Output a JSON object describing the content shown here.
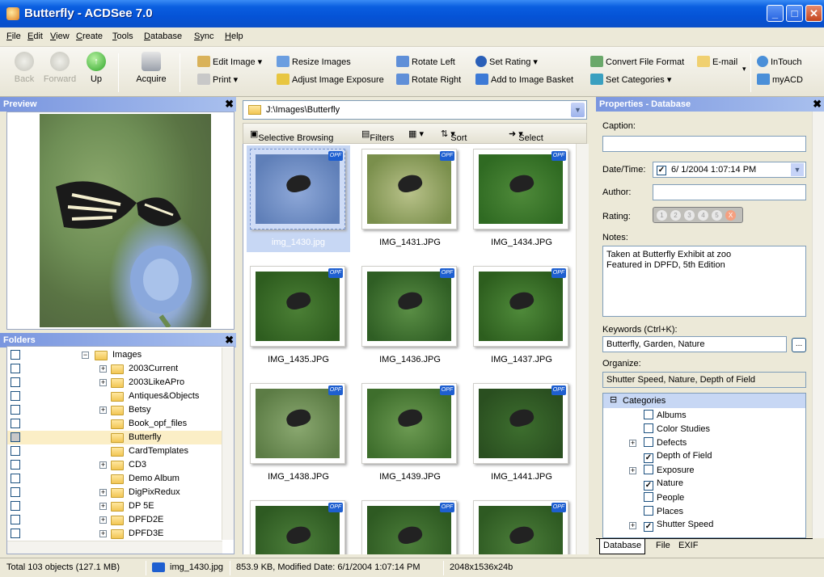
{
  "window": {
    "title": "Butterfly - ACDSee 7.0"
  },
  "menu": [
    "File",
    "Edit",
    "View",
    "Create",
    "Tools",
    "Database",
    "Sync",
    "Help"
  ],
  "toolbar": {
    "back": "Back",
    "forward": "Forward",
    "up": "Up",
    "acquire": "Acquire",
    "edit_image": "Edit Image",
    "print": "Print",
    "resize_images": "Resize Images",
    "adjust_exposure": "Adjust Image Exposure",
    "rotate_left": "Rotate Left",
    "rotate_right": "Rotate Right",
    "set_rating": "Set Rating",
    "add_to_basket": "Add to Image Basket",
    "convert_format": "Convert File Format",
    "email": "E-mail",
    "set_categories": "Set Categories",
    "intouch": "InTouch",
    "myacd": "myACD"
  },
  "preview": {
    "title": "Preview"
  },
  "folders": {
    "title": "Folders",
    "items": [
      {
        "label": "Images",
        "expand": "−"
      },
      {
        "label": "2003Current",
        "expand": "+"
      },
      {
        "label": "2003LikeAPro",
        "expand": "+"
      },
      {
        "label": "Antiques&Objects",
        "expand": ""
      },
      {
        "label": "Betsy",
        "expand": "+"
      },
      {
        "label": "Book_opf_files",
        "expand": ""
      },
      {
        "label": "Butterfly",
        "expand": ""
      },
      {
        "label": "CardTemplates",
        "expand": ""
      },
      {
        "label": "CD3",
        "expand": "+"
      },
      {
        "label": "Demo Album",
        "expand": ""
      },
      {
        "label": "DigPixRedux",
        "expand": "+"
      },
      {
        "label": "DP 5E",
        "expand": "+"
      },
      {
        "label": "DPFD2E",
        "expand": "+"
      },
      {
        "label": "DPFD3E",
        "expand": "+"
      }
    ]
  },
  "filelist": {
    "path": "J:\\Images\\Butterfly",
    "selective_browsing": "Selective Browsing",
    "filters": "Filters",
    "sort": "Sort",
    "select": "Select",
    "badge": "OPF",
    "thumbs": [
      {
        "name": "img_1430.jpg",
        "selected": true
      },
      {
        "name": "IMG_1431.JPG"
      },
      {
        "name": "IMG_1434.JPG"
      },
      {
        "name": "IMG_1435.JPG"
      },
      {
        "name": "IMG_1436.JPG"
      },
      {
        "name": "IMG_1437.JPG"
      },
      {
        "name": "IMG_1438.JPG"
      },
      {
        "name": "IMG_1439.JPG"
      },
      {
        "name": "IMG_1441.JPG"
      },
      {
        "name": ""
      },
      {
        "name": ""
      },
      {
        "name": ""
      }
    ]
  },
  "properties": {
    "title": "Properties - Database",
    "caption_label": "Caption:",
    "caption_value": "",
    "datetime_label": "Date/Time:",
    "datetime_value": "6/ 1/2004  1:07:14 PM",
    "author_label": "Author:",
    "author_value": "",
    "rating_label": "Rating:",
    "rating_values": [
      "1",
      "2",
      "3",
      "4",
      "5",
      "X"
    ],
    "notes_label": "Notes:",
    "notes_value": "Taken at Butterfly Exhibit at zoo\nFeatured in DPFD, 5th Edition",
    "keywords_label": "Keywords (Ctrl+K):",
    "keywords_value": "Butterfly, Garden, Nature",
    "organize_label": "Organize:",
    "organize_value": "Shutter Speed, Nature, Depth of Field",
    "categories_root": "Categories",
    "categories": [
      {
        "label": "Albums",
        "checked": false,
        "expand": ""
      },
      {
        "label": "Color Studies",
        "checked": false,
        "expand": ""
      },
      {
        "label": "Defects",
        "checked": false,
        "expand": "+"
      },
      {
        "label": "Depth of Field",
        "checked": true,
        "expand": ""
      },
      {
        "label": "Exposure",
        "checked": false,
        "expand": "+"
      },
      {
        "label": "Nature",
        "checked": true,
        "expand": ""
      },
      {
        "label": "People",
        "checked": false,
        "expand": ""
      },
      {
        "label": "Places",
        "checked": false,
        "expand": ""
      },
      {
        "label": "Shutter Speed",
        "checked": true,
        "expand": "+"
      }
    ],
    "tabs": [
      "Database",
      "File",
      "EXIF"
    ]
  },
  "status": {
    "total": "Total 103 objects  (127.1 MB)",
    "file": "img_1430.jpg",
    "details": "853.9 KB, Modified Date: 6/1/2004 1:07:14 PM",
    "dims": "2048x1536x24b"
  }
}
